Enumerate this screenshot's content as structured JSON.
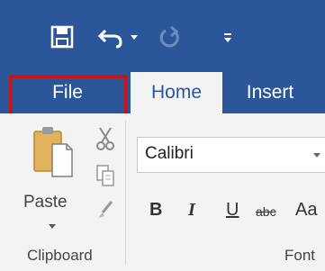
{
  "qat": {
    "save_icon": "save-icon",
    "undo_icon": "undo-icon",
    "redo_icon": "redo-icon",
    "customize_icon": "customize-qat-icon"
  },
  "tabs": {
    "file": "File",
    "home": "Home",
    "insert": "Insert"
  },
  "clipboard": {
    "paste_label": "Paste",
    "group_label": "Clipboard"
  },
  "font": {
    "font_name": "Calibri",
    "bold": "B",
    "italic": "I",
    "underline": "U",
    "strikethrough": "abc",
    "change_case": "Aa",
    "group_label": "Font"
  },
  "colors": {
    "ribbon_blue": "#2b579a",
    "highlight_red": "#c5141b",
    "ribbon_bg": "#f3f3f3"
  }
}
